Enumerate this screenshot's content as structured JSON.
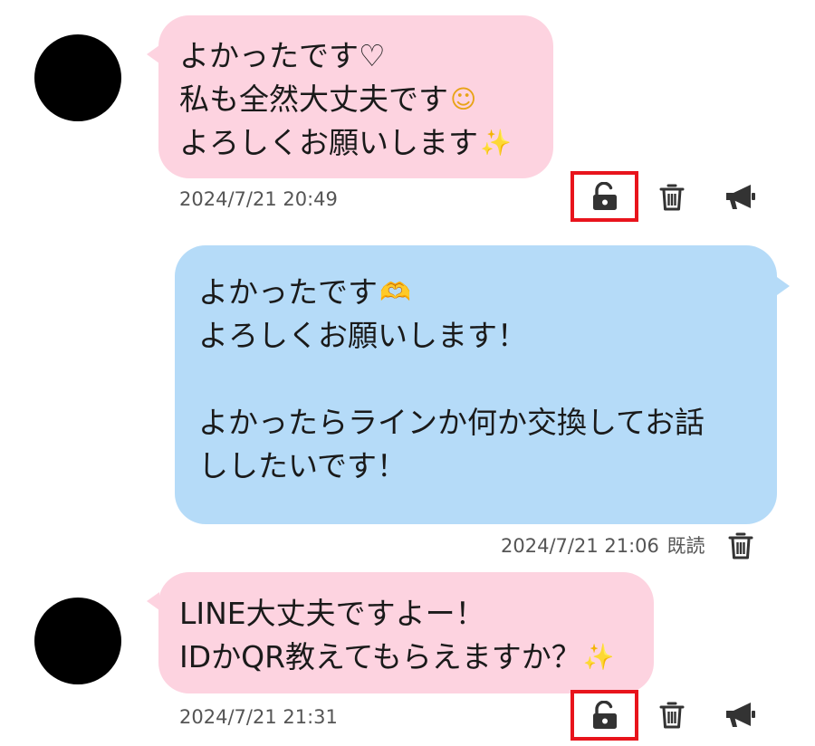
{
  "messages": [
    {
      "direction": "received",
      "lines": [
        "よかったです♡",
        "私も全然大丈夫です",
        "よろしくお願いします"
      ],
      "emojis": [
        "smiling-face",
        "sparkles"
      ],
      "timestamp": "2024/7/21 20:49",
      "actions": [
        "unlock",
        "delete",
        "report"
      ]
    },
    {
      "direction": "sent",
      "lines": [
        "よかったです",
        "よろしくお願いします！",
        "",
        "よかったらラインか何か交換してお話",
        "ししたいです！"
      ],
      "emojis": [
        "heart-hands"
      ],
      "timestamp": "2024/7/21 21:06",
      "read_label": "既読",
      "actions": [
        "delete"
      ]
    },
    {
      "direction": "received",
      "lines": [
        "LINE大丈夫ですよー！",
        "IDかQR教えてもらえますか？"
      ],
      "emojis": [
        "sparkles"
      ],
      "timestamp": "2024/7/21 21:31",
      "actions": [
        "unlock",
        "delete",
        "report"
      ]
    }
  ],
  "highlight_color": "#e8141c",
  "received_bubble_color": "#fdd3e0",
  "sent_bubble_color": "#b5dbf8"
}
